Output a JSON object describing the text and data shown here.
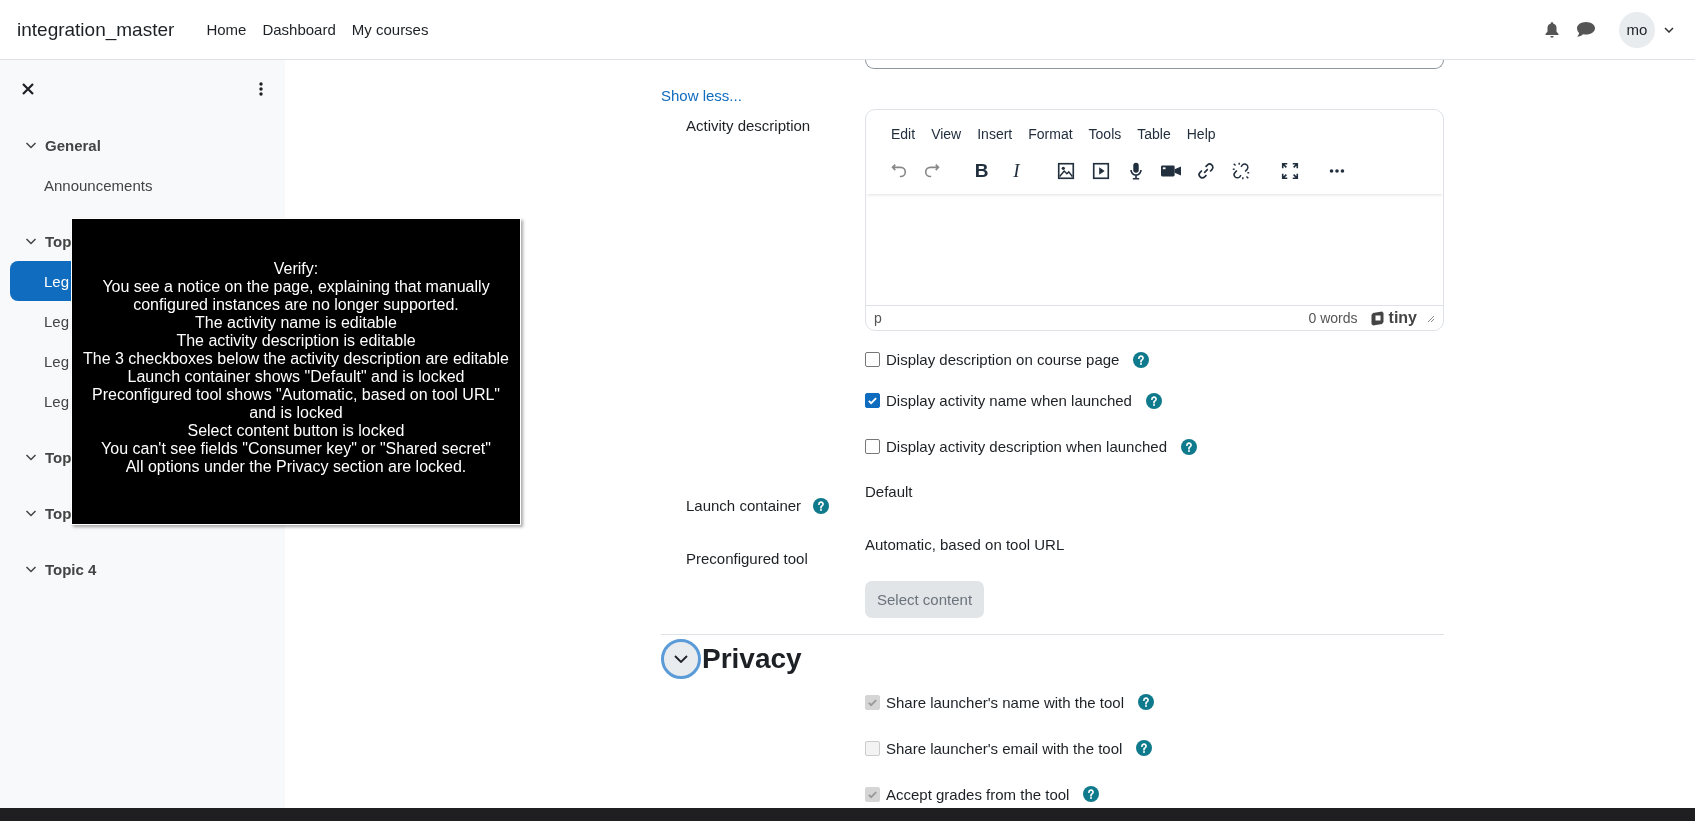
{
  "navbar": {
    "brand": "integration_master",
    "links": [
      "Home",
      "Dashboard",
      "My courses"
    ],
    "avatar": "mo"
  },
  "sidebar": {
    "sections": [
      {
        "title": "General",
        "expanded": true,
        "items": [
          {
            "label": "Announcements",
            "selected": false
          }
        ]
      },
      {
        "title": "Top",
        "expanded": true,
        "items": [
          {
            "label": "Leg",
            "selected": true
          },
          {
            "label": "Leg",
            "selected": false
          },
          {
            "label": "Leg",
            "selected": false
          },
          {
            "label": "Leg",
            "selected": false
          }
        ]
      },
      {
        "title": "Top",
        "expanded": true
      },
      {
        "title": "Top",
        "expanded": true
      },
      {
        "title": "Topic 4",
        "expanded": true
      }
    ]
  },
  "form": {
    "show_less": "Show less...",
    "activity_description": {
      "label": "Activity description",
      "menu": [
        "Edit",
        "View",
        "Insert",
        "Format",
        "Tools",
        "Table",
        "Help"
      ],
      "toolbar": [
        {
          "kind": "undo",
          "disabled": true
        },
        {
          "kind": "redo",
          "disabled": true
        },
        {
          "kind": "bold",
          "glyph": "B",
          "disabled": false
        },
        {
          "kind": "italic",
          "glyph": "I",
          "disabled": false
        },
        {
          "kind": "image",
          "disabled": false
        },
        {
          "kind": "media",
          "disabled": false
        },
        {
          "kind": "mic",
          "disabled": false
        },
        {
          "kind": "video",
          "disabled": false
        },
        {
          "kind": "link",
          "disabled": false
        },
        {
          "kind": "unlink",
          "disabled": false
        },
        {
          "kind": "fullscreen",
          "disabled": false
        },
        {
          "kind": "more",
          "disabled": false
        }
      ],
      "path": "p",
      "word_count": "0 words",
      "brand": "tiny"
    },
    "checkboxes": [
      {
        "label": "Display description on course page",
        "checked": false
      },
      {
        "label": "Display activity name when launched",
        "checked": true
      },
      {
        "label": "Display activity description when launched",
        "checked": false
      }
    ],
    "fields": [
      {
        "label": "Launch container",
        "value": "Default",
        "help": true
      },
      {
        "label": "Preconfigured tool",
        "value": "Automatic, based on tool URL",
        "help": false
      }
    ],
    "select_content": {
      "label": "Select content",
      "disabled": true
    },
    "privacy": {
      "title": "Privacy",
      "expanded": true,
      "options": [
        {
          "label": "Share launcher's name with the tool",
          "checked": true,
          "disabled": true
        },
        {
          "label": "Share launcher's email with the tool",
          "checked": false,
          "disabled": true
        },
        {
          "label": "Accept grades from the tool",
          "checked": true,
          "disabled": true
        }
      ]
    }
  },
  "note": {
    "lines": [
      "Verify:",
      "You see a notice on the page, explaining that manually configured instances are no longer supported.",
      "The activity name is editable",
      "The activity description is editable",
      "The 3 checkboxes below the activity description are editable",
      "Launch container shows \"Default\" and is locked",
      "Preconfigured tool shows \"Automatic, based on tool URL\" and is locked",
      "Select content button is locked",
      "You can't see fields \"Consumer key\" or \"Shared secret\"",
      "All options under the Privacy section are locked."
    ]
  }
}
